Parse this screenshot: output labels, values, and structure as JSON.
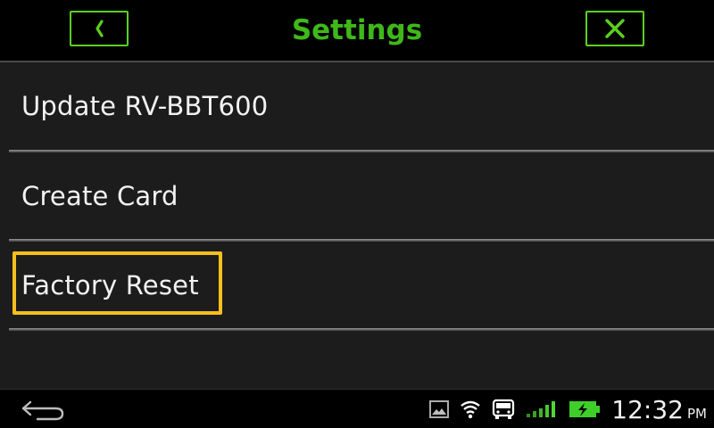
{
  "header": {
    "title": "Settings",
    "back_icon": "chevron-left-icon",
    "close_icon": "close-icon",
    "accent_color": "#3fb81a"
  },
  "menu": {
    "items": [
      {
        "label": "Update RV-BBT600"
      },
      {
        "label": "Create Card"
      },
      {
        "label": "Factory Reset",
        "highlighted": true
      }
    ],
    "highlight_color": "#f5bf1c"
  },
  "system_bar": {
    "time": "12:32",
    "ampm": "PM",
    "icons": [
      "back-arrow-icon",
      "gallery-icon",
      "wifi-icon",
      "bus-icon",
      "signal-icon",
      "battery-charging-icon"
    ],
    "battery_color": "#3fcf2a"
  }
}
